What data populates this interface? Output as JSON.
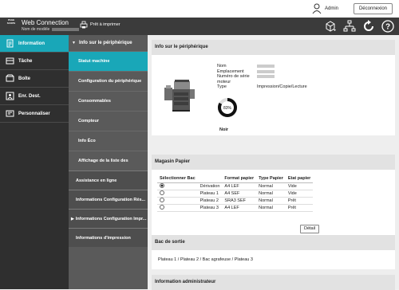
{
  "topbar": {
    "user_label": "Admin",
    "logout_label": "Déconnexion"
  },
  "header": {
    "logo_text": "PAGE SCOPE",
    "brand": "Web Connection",
    "model_label": "Nom de modèle",
    "ready_text": "Prêt à imprimer",
    "icons": [
      "toner-icon",
      "network-icon",
      "refresh-icon",
      "help-icon"
    ]
  },
  "leftmenu": [
    {
      "label": "Information",
      "icon": "info-icon",
      "active": true
    },
    {
      "label": "Tâche",
      "icon": "job-icon",
      "active": false
    },
    {
      "label": "Boîte",
      "icon": "box-icon",
      "active": false
    },
    {
      "label": "Enr. Dest.",
      "icon": "address-icon",
      "active": false
    },
    {
      "label": "Personnaliser",
      "icon": "customize-icon",
      "active": false
    }
  ],
  "submenu": {
    "header": "Info sur le périphérique",
    "items": [
      "Statut machine",
      "Configuration du périphérique",
      "Consommables",
      "Compteur",
      "Info Éco",
      "Affichage de la liste des"
    ],
    "top_items": [
      {
        "label": "Assistance en ligne",
        "arrow": false
      },
      {
        "label": "Informations Configuration Rés...",
        "arrow": false
      },
      {
        "label": "Informations Configuration Impr...",
        "arrow": true
      },
      {
        "label": "Informations d'impression",
        "arrow": false
      }
    ]
  },
  "device_info": {
    "title": "Info sur le périphérique",
    "rows": [
      {
        "k": "Nom",
        "v": ""
      },
      {
        "k": "Emplacement",
        "v": ""
      },
      {
        "k": "Numéro de série moteur",
        "v": ""
      },
      {
        "k": "Type",
        "v": "Impression/Copie/Lecture"
      }
    ],
    "toner_percent": "83%",
    "toner_value": 0.83,
    "toner_color": "Noir"
  },
  "paper": {
    "title": "Magasin Papier",
    "headers": [
      "Sélectionner Bac",
      "",
      "Format papier",
      "Type Papier",
      "Etat papier"
    ],
    "rows": [
      {
        "selected": true,
        "bac": "Dérivation",
        "format": "A4 LEF",
        "type": "Normal",
        "etat": "Vide"
      },
      {
        "selected": false,
        "bac": "Plateau 1",
        "format": "A4 SEF",
        "type": "Normal",
        "etat": "Vide"
      },
      {
        "selected": false,
        "bac": "Plateau 2",
        "format": "SRA3 SEF",
        "type": "Normal",
        "etat": "Prêt"
      },
      {
        "selected": false,
        "bac": "Plateau 3",
        "format": "A4 LEF",
        "type": "Normal",
        "etat": "Prêt"
      }
    ],
    "detail_label": "Détail"
  },
  "output": {
    "title": "Bac de sortie",
    "text": "Plateau 1 / Plateau 2 / Bac agrafeuse / Plateau 3"
  },
  "admin": {
    "title": "Information administrateur"
  },
  "colors": {
    "accent": "#19a7b8",
    "header": "#3b3b3b",
    "leftmenu": "#2f2f2f",
    "submenu": "#5a5a5a"
  }
}
